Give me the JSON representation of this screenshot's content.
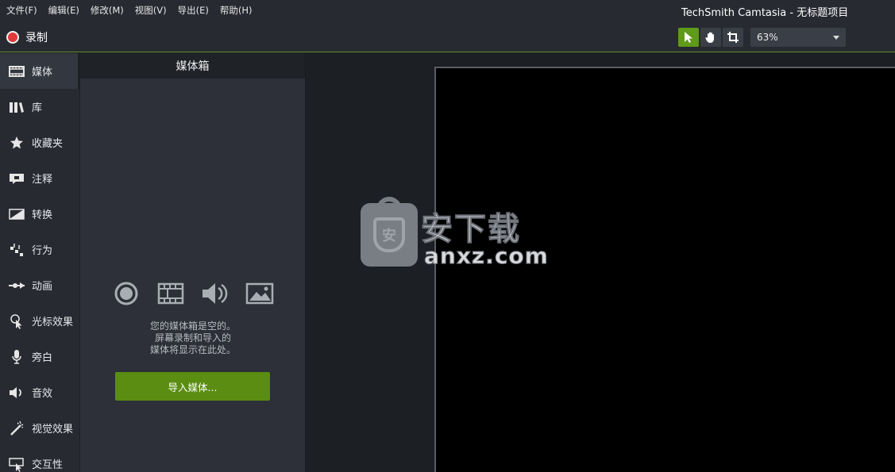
{
  "window": {
    "title": "TechSmith Camtasia - 无标题项目"
  },
  "menu": [
    "文件(F)",
    "编辑(E)",
    "修改(M)",
    "视图(V)",
    "导出(E)",
    "帮助(H)"
  ],
  "toolbar": {
    "record_label": "录制",
    "zoom_value": "63%",
    "tools": [
      "pointer-icon",
      "hand-pan-icon",
      "crop-icon"
    ]
  },
  "sidebar": {
    "items": [
      {
        "label": "媒体",
        "icon": "film-icon",
        "active": true
      },
      {
        "label": "库",
        "icon": "library-icon"
      },
      {
        "label": "收藏夹",
        "icon": "star-icon"
      },
      {
        "label": "注释",
        "icon": "annotation-icon"
      },
      {
        "label": "转换",
        "icon": "transition-icon"
      },
      {
        "label": "行为",
        "icon": "behavior-icon"
      },
      {
        "label": "动画",
        "icon": "animation-icon"
      },
      {
        "label": "光标效果",
        "icon": "cursor-effect-icon"
      },
      {
        "label": "旁白",
        "icon": "microphone-icon"
      },
      {
        "label": "音效",
        "icon": "speaker-icon"
      },
      {
        "label": "视觉效果",
        "icon": "magic-wand-icon"
      },
      {
        "label": "交互性",
        "icon": "interactivity-icon"
      }
    ]
  },
  "media_bin": {
    "header": "媒体箱",
    "empty_line1": "您的媒体箱是空的。",
    "empty_line2": "屏幕录制和导入的",
    "empty_line3": "媒体将显示在此处。",
    "import_button": "导入媒体..."
  },
  "watermark": {
    "logo_glyph": "安",
    "cn_text": "安下载",
    "en_text": "anxz.com"
  },
  "colors": {
    "accent_green": "#5a8d12",
    "record_red": "#e03a3a",
    "canvas": "#000000"
  }
}
